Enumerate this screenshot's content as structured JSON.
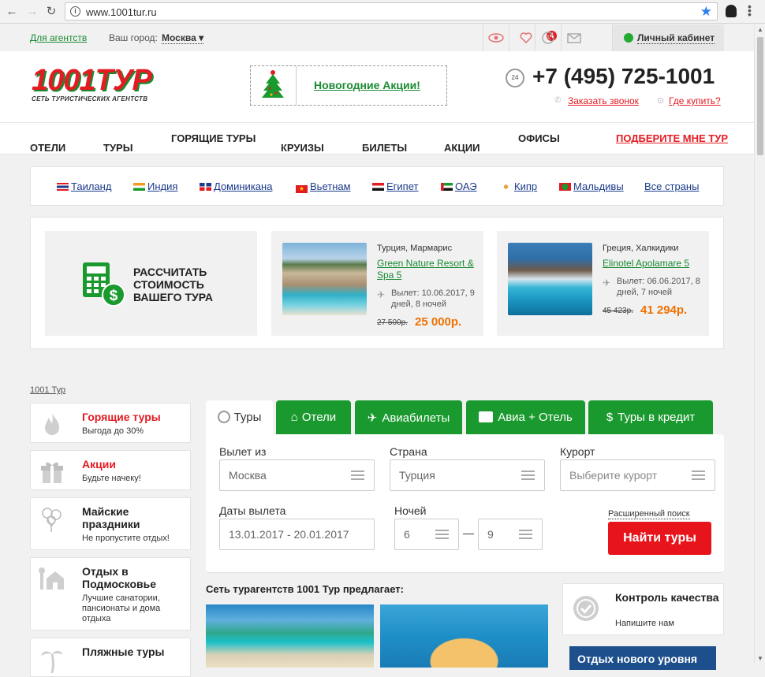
{
  "browser": {
    "url": "www.1001tur.ru"
  },
  "topbar": {
    "agent_link": "Для агентств",
    "city_label": "Ваш город:",
    "city": "Москва ▾",
    "fav_count": "4",
    "cabinet": "Личный кабинет"
  },
  "header": {
    "logo_text": "1001ТУР",
    "logo_tagline": "СЕТЬ ТУРИСТИЧЕСКИХ АГЕНТСТВ",
    "promo": "Новогодние Акции!",
    "phone_badge": "24",
    "phone": "+7 (495) 725-1001",
    "callback": "Заказать звонок",
    "where_buy": "Где купить?"
  },
  "nav": {
    "hotels": "ОТЕЛИ",
    "tours": "ТУРЫ",
    "hot": "ГОРЯЩИЕ ТУРЫ",
    "cruises": "КРУИЗЫ",
    "tickets": "БИЛЕТЫ",
    "promos": "АКЦИИ",
    "offices": "ОФИСЫ",
    "pick": "ПОДБЕРИТЕ МНЕ ТУР"
  },
  "countries": [
    {
      "label": "Таиланд"
    },
    {
      "label": "Индия"
    },
    {
      "label": "Доминикана"
    },
    {
      "label": "Вьетнам"
    },
    {
      "label": "Египет"
    },
    {
      "label": "ОАЭ"
    },
    {
      "label": "Кипр"
    },
    {
      "label": "Мальдивы"
    },
    {
      "label": "Все страны"
    }
  ],
  "calc": {
    "text": "РАССЧИТАТЬ СТОИМОСТЬ ВАШЕГО ТУРА"
  },
  "deals": [
    {
      "location": "Турция, Мармарис",
      "hotel": "Green Nature Resort & Spa 5",
      "departure": "Вылет: 10.06.2017, 9 дней, 8 ночей",
      "old_price": "27 500р.",
      "price": "25 000р."
    },
    {
      "location": "Греция, Халкидики",
      "hotel": "Elinotel Apolamare 5",
      "departure": "Вылет: 06.06.2017, 8 дней, 7 ночей",
      "old_price": "45 423р.",
      "price": "41 294р."
    }
  ],
  "breadcrumb": "1001 Тур",
  "sidebar": [
    {
      "title": "Горящие туры",
      "sub": "Выгода до 30%"
    },
    {
      "title": "Акции",
      "sub": "Будьте начеку!"
    },
    {
      "title": "Майские праздники",
      "sub": "Не пропустите отдых!"
    },
    {
      "title": "Отдых в Подмосковье",
      "sub": "Лучшие санатории, пансионаты и дома отдыха"
    },
    {
      "title": "Пляжные туры",
      "sub": ""
    }
  ],
  "tabs": [
    {
      "label": "Туры"
    },
    {
      "label": "Отели"
    },
    {
      "label": "Авиабилеты"
    },
    {
      "label": "Авиа + Отель"
    },
    {
      "label": "Туры в кредит"
    }
  ],
  "search": {
    "from_label": "Вылет из",
    "from_value": "Москва",
    "country_label": "Страна",
    "country_value": "Турция",
    "resort_label": "Курорт",
    "resort_placeholder": "Выберите курорт",
    "dates_label": "Даты вылета",
    "dates_value": "13.01.2017 - 20.01.2017",
    "nights_label": "Ночей",
    "nights_from": "6",
    "nights_to": "9",
    "advanced": "Расширенный поиск",
    "find": "Найти туры"
  },
  "offers_title": "Сеть турагентств 1001 Тур предлагает:",
  "quality": {
    "title": "Контроль качества",
    "sub": "Напишите нам"
  },
  "banner": "Отдых нового уровня",
  "colors": {
    "brand_green": "#1a9a2e",
    "brand_red": "#e31b23",
    "price_orange": "#f07000"
  }
}
